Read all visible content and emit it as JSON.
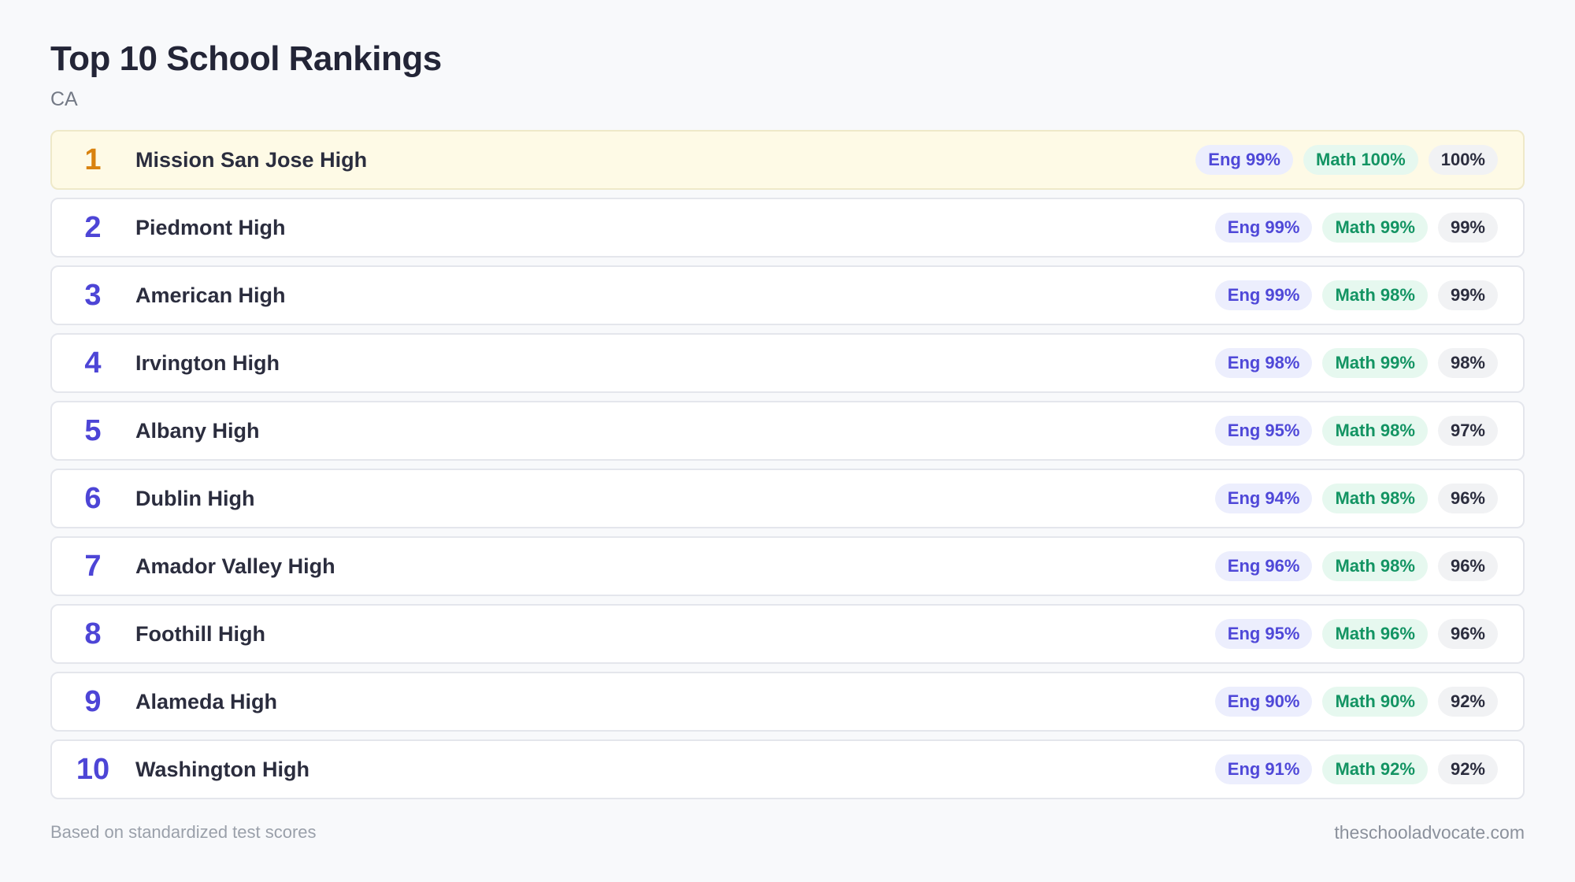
{
  "header": {
    "title": "Top 10 School Rankings",
    "subtitle": "CA"
  },
  "rankings": [
    {
      "rank": "1",
      "name": "Mission San Jose High",
      "eng": "Eng 99%",
      "math": "Math 100%",
      "overall": "100%"
    },
    {
      "rank": "2",
      "name": "Piedmont High",
      "eng": "Eng 99%",
      "math": "Math 99%",
      "overall": "99%"
    },
    {
      "rank": "3",
      "name": "American High",
      "eng": "Eng 99%",
      "math": "Math 98%",
      "overall": "99%"
    },
    {
      "rank": "4",
      "name": "Irvington High",
      "eng": "Eng 98%",
      "math": "Math 99%",
      "overall": "98%"
    },
    {
      "rank": "5",
      "name": "Albany High",
      "eng": "Eng 95%",
      "math": "Math 98%",
      "overall": "97%"
    },
    {
      "rank": "6",
      "name": "Dublin High",
      "eng": "Eng 94%",
      "math": "Math 98%",
      "overall": "96%"
    },
    {
      "rank": "7",
      "name": "Amador Valley High",
      "eng": "Eng 96%",
      "math": "Math 98%",
      "overall": "96%"
    },
    {
      "rank": "8",
      "name": "Foothill High",
      "eng": "Eng 95%",
      "math": "Math 96%",
      "overall": "96%"
    },
    {
      "rank": "9",
      "name": "Alameda High",
      "eng": "Eng 90%",
      "math": "Math 90%",
      "overall": "92%"
    },
    {
      "rank": "10",
      "name": "Washington High",
      "eng": "Eng 91%",
      "math": "Math 92%",
      "overall": "92%"
    }
  ],
  "footer": {
    "note": "Based on standardized test scores",
    "site": "theschooladvocate.com"
  },
  "colors": {
    "accent": "#4d45d6",
    "top_rank": "#d9820f",
    "top_row_bg": "#fefae6",
    "eng": "#4f48d8",
    "math": "#139463"
  }
}
